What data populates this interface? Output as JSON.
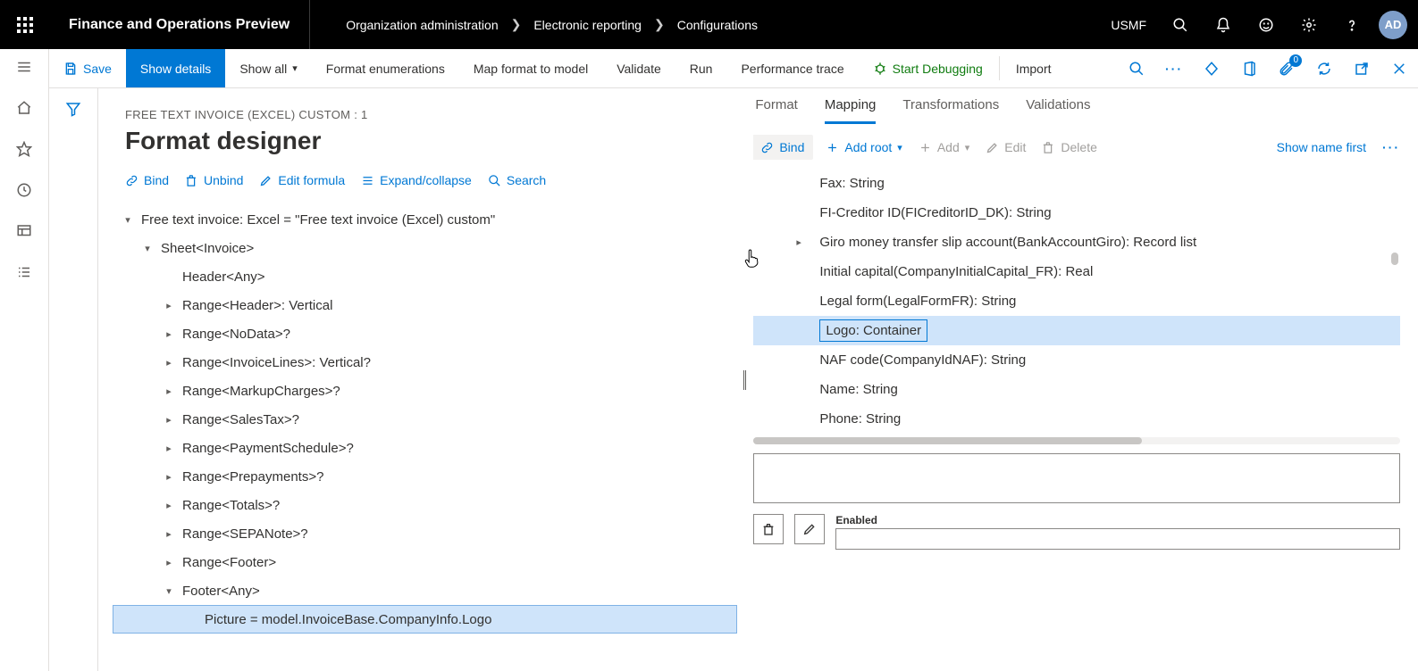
{
  "header": {
    "app_title": "Finance and Operations Preview",
    "breadcrumbs": [
      "Organization administration",
      "Electronic reporting",
      "Configurations"
    ],
    "company": "USMF",
    "avatar": "AD"
  },
  "cmdbar": {
    "save": "Save",
    "show_details": "Show details",
    "show_all": "Show all",
    "format_enum": "Format enumerations",
    "map_format": "Map format to model",
    "validate": "Validate",
    "run": "Run",
    "perf_trace": "Performance trace",
    "start_debug": "Start Debugging",
    "import": "Import",
    "badge": "0"
  },
  "page": {
    "subtitle": "FREE TEXT INVOICE (EXCEL) CUSTOM : 1",
    "title": "Format designer"
  },
  "left_toolbar": {
    "bind": "Bind",
    "unbind": "Unbind",
    "edit_formula": "Edit formula",
    "expand": "Expand/collapse",
    "search": "Search"
  },
  "left_tree": [
    {
      "indent": 0,
      "caret": "down",
      "label": "Free text invoice: Excel = \"Free text invoice (Excel) custom\""
    },
    {
      "indent": 1,
      "caret": "down",
      "label": "Sheet<Invoice>"
    },
    {
      "indent": 2,
      "caret": "",
      "label": "Header<Any>"
    },
    {
      "indent": 2,
      "caret": "right",
      "label": "Range<Header>: Vertical"
    },
    {
      "indent": 2,
      "caret": "right",
      "label": "Range<NoData>?"
    },
    {
      "indent": 2,
      "caret": "right",
      "label": "Range<InvoiceLines>: Vertical?"
    },
    {
      "indent": 2,
      "caret": "right",
      "label": "Range<MarkupCharges>?"
    },
    {
      "indent": 2,
      "caret": "right",
      "label": "Range<SalesTax>?"
    },
    {
      "indent": 2,
      "caret": "right",
      "label": "Range<PaymentSchedule>?"
    },
    {
      "indent": 2,
      "caret": "right",
      "label": "Range<Prepayments>?"
    },
    {
      "indent": 2,
      "caret": "right",
      "label": "Range<Totals>?"
    },
    {
      "indent": 2,
      "caret": "right",
      "label": "Range<SEPANote>?"
    },
    {
      "indent": 2,
      "caret": "right",
      "label": "Range<Footer>"
    },
    {
      "indent": 2,
      "caret": "down",
      "label": "Footer<Any>"
    },
    {
      "indent": 3,
      "caret": "",
      "label": "Picture = model.InvoiceBase.CompanyInfo.Logo",
      "selected": true
    }
  ],
  "right_tabs": {
    "format": "Format",
    "mapping": "Mapping",
    "transformations": "Transformations",
    "validations": "Validations"
  },
  "right_toolbar": {
    "bind": "Bind",
    "add_root": "Add root",
    "add": "Add",
    "edit": "Edit",
    "delete": "Delete",
    "show_name_first": "Show name first"
  },
  "right_tree": [
    {
      "caret": "",
      "label": "Fax: String"
    },
    {
      "caret": "",
      "label": "FI-Creditor ID(FICreditorID_DK): String"
    },
    {
      "caret": "right",
      "label": "Giro money transfer slip account(BankAccountGiro): Record list"
    },
    {
      "caret": "",
      "label": "Initial capital(CompanyInitialCapital_FR): Real"
    },
    {
      "caret": "",
      "label": "Legal form(LegalFormFR): String"
    },
    {
      "caret": "",
      "label": "Logo: Container",
      "selected": true
    },
    {
      "caret": "",
      "label": "NAF code(CompanyIdNAF): String"
    },
    {
      "caret": "",
      "label": "Name: String"
    },
    {
      "caret": "",
      "label": "Phone: String"
    }
  ],
  "lower": {
    "enabled_label": "Enabled"
  }
}
